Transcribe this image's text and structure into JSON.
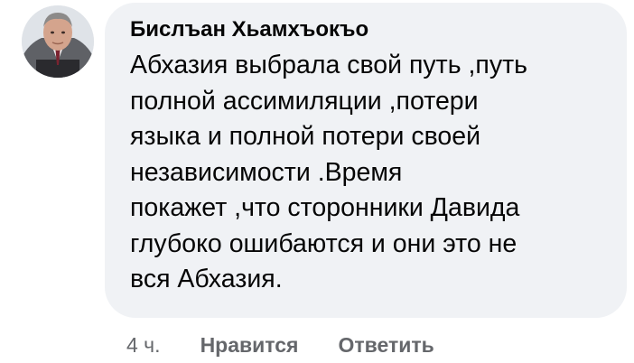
{
  "comment": {
    "author": "Бислъан Хьамхъокъо",
    "text": "Абхазия выбрала свой путь ,путь\nполной ассимиляции ,потери\nязыка и полной потери своей\nнезависимости .Время\nпокажет ,что сторонники Давида\nглубоко ошибаются и они это не\nвся Абхазия.",
    "time": "4 ч.",
    "like_label": "Нравится",
    "reply_label": "Ответить"
  },
  "colors": {
    "bubble": "#f0f2f5",
    "text": "#050505",
    "meta": "#65676b"
  }
}
